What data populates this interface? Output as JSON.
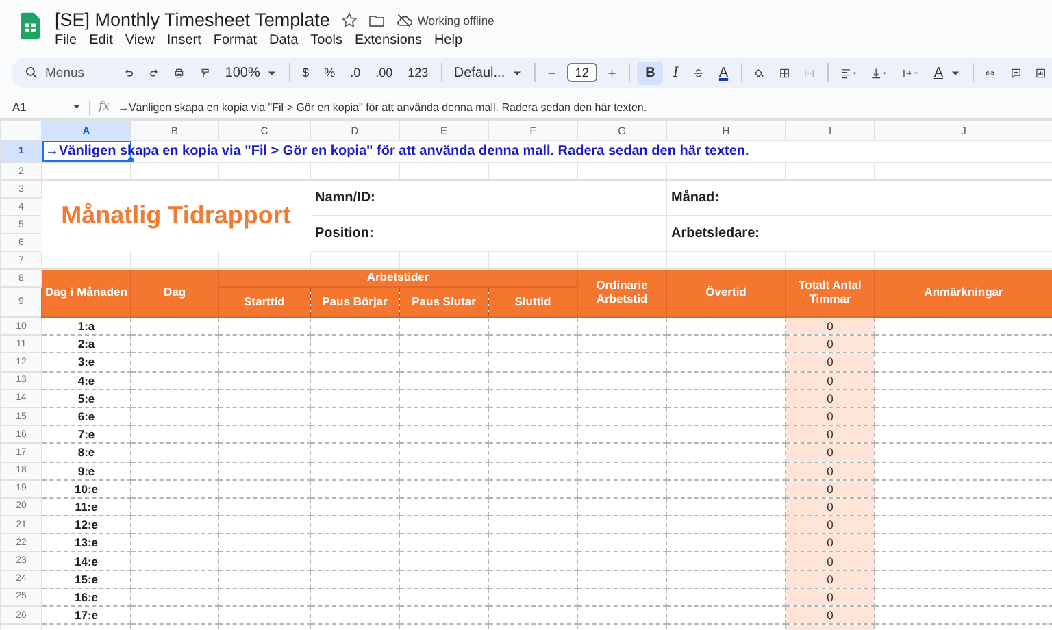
{
  "document": {
    "title": "[SE] Monthly Timesheet Template",
    "status": "Working offline"
  },
  "menu": [
    "File",
    "Edit",
    "View",
    "Insert",
    "Format",
    "Data",
    "Tools",
    "Extensions",
    "Help"
  ],
  "toolbar": {
    "search": {
      "placeholder": "Menus"
    },
    "zoom": "100%",
    "currency": "$",
    "percent": "%",
    "decrease_decimal": ".0",
    "increase_decimal": ".00",
    "number_format": "123",
    "font": "Defaul...",
    "font_size": "12",
    "bold": {
      "label": "B",
      "on": true
    },
    "italic": "I",
    "text_color": "A",
    "text_rotation": "A"
  },
  "formula_bar": {
    "cell": "A1",
    "function_label": "fx",
    "content": "→Vänligen skapa en kopia via \"Fil > Gör en kopia\" för att använda denna mall. Radera sedan den här texten."
  },
  "sheet": {
    "columns": [
      {
        "label": "A",
        "selected": true
      },
      {
        "label": "B",
        "selected": false
      },
      {
        "label": "C",
        "selected": false
      },
      {
        "label": "D",
        "selected": false
      },
      {
        "label": "E",
        "selected": false
      },
      {
        "label": "F",
        "selected": false
      },
      {
        "label": "G",
        "selected": false
      },
      {
        "label": "H",
        "selected": false
      },
      {
        "label": "I",
        "selected": false
      },
      {
        "label": "J",
        "selected": false
      }
    ],
    "row_numbers": [
      {
        "label": "1",
        "selected": true
      },
      {
        "label": "2",
        "selected": false
      },
      {
        "label": "3",
        "selected": false
      },
      {
        "label": "4",
        "selected": false
      },
      {
        "label": "5",
        "selected": false
      },
      {
        "label": "6",
        "selected": false
      },
      {
        "label": "7",
        "selected": false
      },
      {
        "label": "8",
        "selected": false
      },
      {
        "label": "9",
        "selected": false
      },
      {
        "label": "10",
        "selected": false
      },
      {
        "label": "11",
        "selected": false
      },
      {
        "label": "12",
        "selected": false
      },
      {
        "label": "13",
        "selected": false
      },
      {
        "label": "14",
        "selected": false
      },
      {
        "label": "15",
        "selected": false
      },
      {
        "label": "16",
        "selected": false
      },
      {
        "label": "17",
        "selected": false
      },
      {
        "label": "18",
        "selected": false
      },
      {
        "label": "19",
        "selected": false
      },
      {
        "label": "20",
        "selected": false
      },
      {
        "label": "21",
        "selected": false
      },
      {
        "label": "22",
        "selected": false
      },
      {
        "label": "23",
        "selected": false
      },
      {
        "label": "24",
        "selected": false
      },
      {
        "label": "25",
        "selected": false
      },
      {
        "label": "26",
        "selected": false
      }
    ],
    "notice": "→Vänligen skapa en kopia via \"Fil > Gör en kopia\" för att använda denna mall. Radera sedan den här texten.",
    "report_title": "Månatlig Tidrapport",
    "fields": [
      {
        "label": "Namn/ID:"
      },
      {
        "label": "Månad:"
      },
      {
        "label": "Position:"
      },
      {
        "label": "Arbetsledare:"
      }
    ],
    "headers": {
      "day_of_month": "Dag i Månaden",
      "day": "Dag",
      "work_times": "Arbetstider",
      "start": "Starttid",
      "break_start": "Paus Börjar",
      "break_end": "Paus Slutar",
      "end": "Sluttid",
      "regular": "Ordinarie Arbetstid",
      "overtime": "Övertid",
      "total": "Totalt Antal Timmar",
      "remarks": "Anmärkningar"
    },
    "days": [
      {
        "day": "1:a",
        "total": "0"
      },
      {
        "day": "2:a",
        "total": "0"
      },
      {
        "day": "3:e",
        "total": "0"
      },
      {
        "day": "4:e",
        "total": "0"
      },
      {
        "day": "5:e",
        "total": "0"
      },
      {
        "day": "6:e",
        "total": "0"
      },
      {
        "day": "7:e",
        "total": "0"
      },
      {
        "day": "8:e",
        "total": "0"
      },
      {
        "day": "9:e",
        "total": "0"
      },
      {
        "day": "10:e",
        "total": "0"
      },
      {
        "day": "11:e",
        "total": "0"
      },
      {
        "day": "12:e",
        "total": "0"
      },
      {
        "day": "13:e",
        "total": "0"
      },
      {
        "day": "14:e",
        "total": "0"
      },
      {
        "day": "15:e",
        "total": "0"
      },
      {
        "day": "16:e",
        "total": "0"
      },
      {
        "day": "17:e",
        "total": "0"
      }
    ]
  }
}
